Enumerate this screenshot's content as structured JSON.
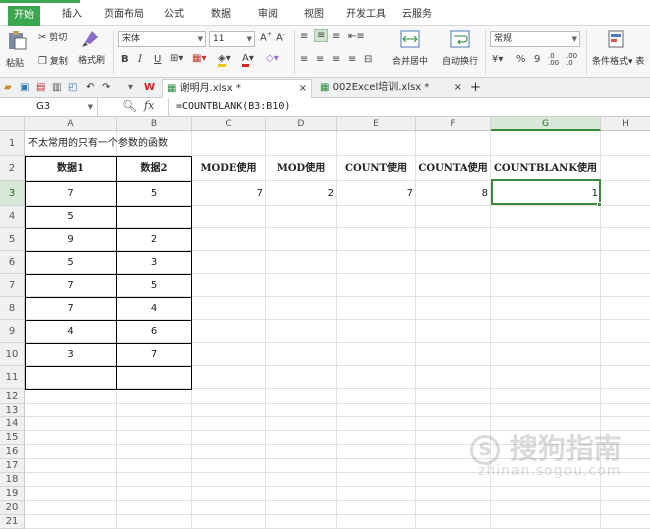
{
  "menu": {
    "tabs": [
      "开始",
      "插入",
      "页面布局",
      "公式",
      "数据",
      "审阅",
      "视图",
      "开发工具",
      "云服务"
    ],
    "active": "开始"
  },
  "ribbon": {
    "paste": "粘贴",
    "cut": "剪切",
    "copy": "复制",
    "format_painter": "格式刷",
    "font_name": "宋体",
    "font_size": "11",
    "bold": "B",
    "italic": "I",
    "underline": "U",
    "font_color_letter": "A",
    "merge_center": "合并居中",
    "wrap_text": "自动换行",
    "number_format": "常规",
    "percent": "%",
    "thousands": "9",
    "conditional_format": "条件格式",
    "next_label": "表"
  },
  "doc_tabs": {
    "tab1": "谢明月.xlsx *",
    "tab2": "002Excel培训.xlsx *",
    "close": "×",
    "add": "+"
  },
  "formula_bar": {
    "name_box": "G3",
    "fx": "fx",
    "formula": "=COUNTBLANK(B3:B10)"
  },
  "grid": {
    "col_headers": [
      "A",
      "B",
      "C",
      "D",
      "E",
      "F",
      "G",
      "H"
    ],
    "row_headers": [
      "1",
      "2",
      "3",
      "4",
      "5",
      "6",
      "7",
      "8",
      "9",
      "10",
      "11",
      "12",
      "13",
      "14",
      "15",
      "16",
      "17",
      "18",
      "19",
      "20",
      "21"
    ],
    "title": "不太常用的只有一个参数的函数",
    "header_row": [
      "数据1",
      "数据2",
      "MODE使用",
      "MOD使用",
      "COUNT使用",
      "COUNTA使用",
      "COUNTBLANK使用"
    ],
    "result_row": [
      "7",
      "5",
      "7",
      "2",
      "7",
      "8",
      "1"
    ],
    "data_col_a": [
      "5",
      "9",
      "5",
      "7",
      "7",
      "4",
      "3"
    ],
    "data_col_b": [
      "",
      "2",
      "3",
      "5",
      "4",
      "6",
      "7"
    ]
  },
  "watermark": {
    "text": "搜狗指南",
    "url": "zhinan.sogou.com"
  }
}
